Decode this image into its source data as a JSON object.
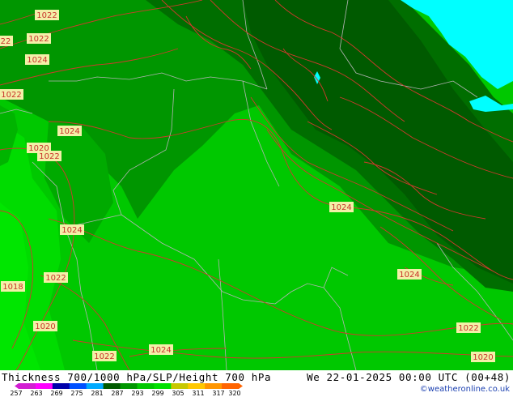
{
  "header": {
    "product_title": "Thickness 700/1000 hPa/SLP/Height 700 hPa",
    "valid_time": "We 22-01-2025 00:00 UTC (00+48)"
  },
  "footer": {
    "copyright": "©weatheronline.co.uk"
  },
  "legend": {
    "ticks": [
      "257",
      "263",
      "269",
      "275",
      "281",
      "287",
      "293",
      "299",
      "305",
      "311",
      "317",
      "320"
    ],
    "colors": [
      "#d21ed2",
      "#ff00ff",
      "#0000aa",
      "#0050ff",
      "#00aaff",
      "#005a00",
      "#009600",
      "#00c800",
      "#00e100",
      "#c8c800",
      "#ffc800",
      "#ff9600",
      "#ff6400"
    ]
  },
  "pressure_labels": [
    "1022",
    "1022",
    "22",
    "1024",
    "1022",
    "1024",
    "1020",
    "1022",
    "1024",
    "1022",
    "1018",
    "1020",
    "1022",
    "1024",
    "1024",
    "1024",
    "1022",
    "1020"
  ],
  "colors": {
    "dark_green": "#006400",
    "mid_green": "#009600",
    "light_green": "#00c800",
    "bright_green": "#00dc00",
    "sea": "#00ffff",
    "isobar": "#d03a2c",
    "border": "#b4b4b4"
  }
}
